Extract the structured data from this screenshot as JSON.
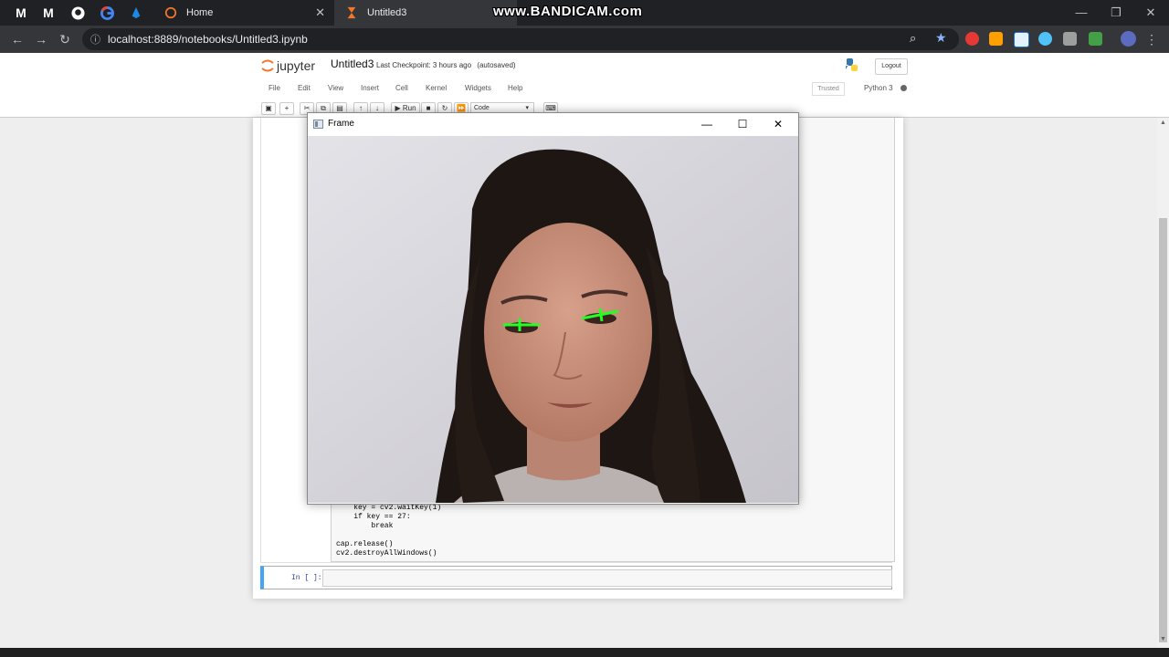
{
  "browser": {
    "tabs": [
      {
        "label": "Home"
      },
      {
        "label": "Untitled3"
      }
    ],
    "pinned": [
      "M",
      "M"
    ],
    "watermark": "www.BANDICAM.com",
    "url": "localhost:8889/notebooks/Untitled3.ipynb"
  },
  "jupyter": {
    "logo": "jupyter",
    "title": "Untitled3",
    "checkpoint": "Last Checkpoint: 3 hours ago",
    "autosaved": "(autosaved)",
    "logout": "Logout",
    "menu": [
      "File",
      "Edit",
      "View",
      "Insert",
      "Cell",
      "Kernel",
      "Widgets",
      "Help"
    ],
    "trusted": "Trusted",
    "kernel": "Python 3",
    "run": "Run",
    "cell_type": "Code",
    "code_lines": [
      "    key = cv2.waitKey(1)",
      "    if key == 27:",
      "        break",
      "",
      "cap.release()",
      "cv2.destroyAllWindows()"
    ],
    "prompt": "In [ ]:"
  },
  "frame_window": {
    "title": "Frame"
  },
  "colors": {
    "tab_bg": "#202124",
    "toolbar_bg": "#35363a",
    "cell_accent": "#42a5f5",
    "eye_marker": "#22ff22"
  }
}
